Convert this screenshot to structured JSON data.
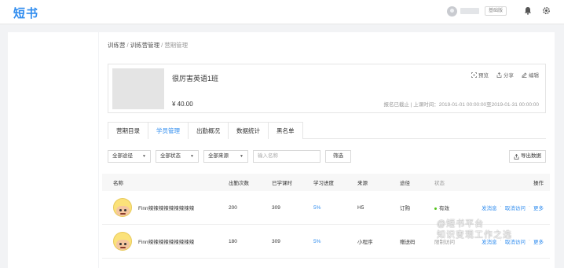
{
  "app": {
    "logo": "短书",
    "version_badge": "基础版"
  },
  "breadcrumb": {
    "item1": "训练营",
    "item2": "训练营管理",
    "current": "营期管理",
    "sep1": "/",
    "sep2": "/"
  },
  "course": {
    "name": "很厉害英语1班",
    "price": "¥ 40.00",
    "actions": {
      "preview": "预览",
      "share": "分享",
      "edit": "编辑"
    },
    "meta": "报名已截止 | 上课时间：2019-01-01 00:00:00至2019-01-31 00:00:00"
  },
  "tabs": [
    "营期目录",
    "学员管理",
    "出勤概况",
    "数据统计",
    "黑名单"
  ],
  "filters": {
    "path": "全部途径",
    "status": "全部状态",
    "source": "全部来源",
    "search_placeholder": "输入名称",
    "filter_button": "筛选",
    "export_button": "导出数据"
  },
  "table": {
    "headers": {
      "name": "名称",
      "attendance": "出勤次数",
      "learned": "已学课时",
      "progress": "学习进度",
      "source": "来源",
      "path": "途径",
      "status": "状态",
      "ops": "操作"
    },
    "rows": [
      {
        "name": "Finn辣辣辣辣辣辣辣辣辣",
        "attendance": "200",
        "learned": "309",
        "progress": "5%",
        "source": "H5",
        "path": "订购",
        "status": "有效",
        "op1": "发消息",
        "op2": "取消访问",
        "op3": "更多"
      },
      {
        "name": "Finn辣辣辣辣辣辣辣辣辣",
        "attendance": "180",
        "learned": "309",
        "progress": "5%",
        "source": "小程序",
        "path": "赠送码",
        "status": "限制访问",
        "op1": "发消息",
        "op2": "取消访问",
        "op3": "更多"
      }
    ]
  },
  "watermark": {
    "line1": "@短书平台",
    "line2": "知识变现工作之选"
  },
  "colors": {
    "accent": "#2f8cef",
    "status_ok": "#52c41a"
  },
  "icons": [
    "bell-icon",
    "gear-icon",
    "preview-icon",
    "share-icon",
    "edit-icon",
    "export-icon",
    "caret-down-icon"
  ]
}
